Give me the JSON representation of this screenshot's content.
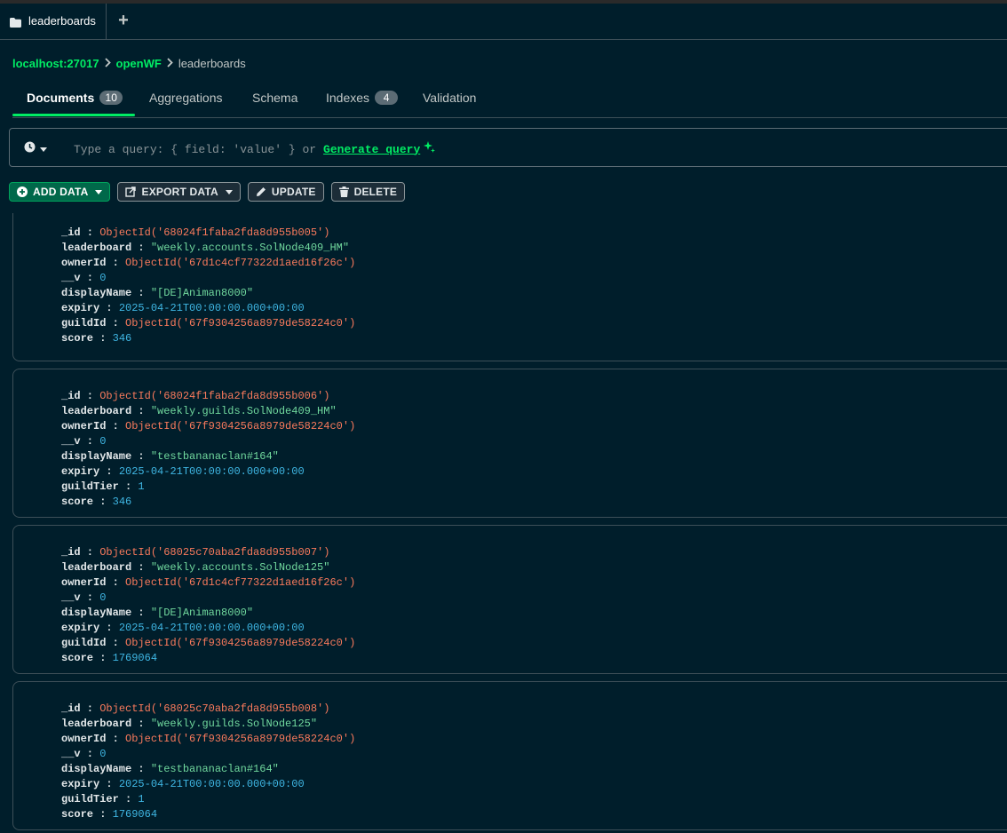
{
  "tab": {
    "label": "leaderboards",
    "new_tab": "+"
  },
  "breadcrumb": {
    "host": "localhost:27017",
    "db": "openWF",
    "collection": "leaderboards"
  },
  "nav": {
    "documents": "Documents",
    "documents_count": "10",
    "aggregations": "Aggregations",
    "schema": "Schema",
    "indexes": "Indexes",
    "indexes_count": "4",
    "validation": "Validation"
  },
  "query": {
    "placeholder": "Type a query: { field: 'value' } or",
    "generate": "Generate query"
  },
  "toolbar": {
    "add": "ADD DATA",
    "export": "EXPORT DATA",
    "update": "UPDATE",
    "delete": "DELETE"
  },
  "documents": [
    {
      "rows": [
        {
          "k": "_id",
          "v": "ObjectId('68024f1faba2fda8d955b005')",
          "t": "oid"
        },
        {
          "k": "leaderboard",
          "v": "\"weekly.accounts.SolNode409_HM\"",
          "t": "str"
        },
        {
          "k": "ownerId",
          "v": "ObjectId('67d1c4cf77322d1aed16f26c')",
          "t": "oid"
        },
        {
          "k": "__v",
          "v": "0",
          "t": "num"
        },
        {
          "k": "displayName",
          "v": "\"[DE]Animan8000\"",
          "t": "str"
        },
        {
          "k": "expiry",
          "v": "2025-04-21T00:00:00.000+00:00",
          "t": "date"
        },
        {
          "k": "guildId",
          "v": "ObjectId('67f9304256a8979de58224c0')",
          "t": "oid"
        },
        {
          "k": "score",
          "v": "346",
          "t": "num"
        }
      ]
    },
    {
      "rows": [
        {
          "k": "_id",
          "v": "ObjectId('68024f1faba2fda8d955b006')",
          "t": "oid"
        },
        {
          "k": "leaderboard",
          "v": "\"weekly.guilds.SolNode409_HM\"",
          "t": "str"
        },
        {
          "k": "ownerId",
          "v": "ObjectId('67f9304256a8979de58224c0')",
          "t": "oid"
        },
        {
          "k": "__v",
          "v": "0",
          "t": "num"
        },
        {
          "k": "displayName",
          "v": "\"testbananaclan#164\"",
          "t": "str"
        },
        {
          "k": "expiry",
          "v": "2025-04-21T00:00:00.000+00:00",
          "t": "date"
        },
        {
          "k": "guildTier",
          "v": "1",
          "t": "num"
        },
        {
          "k": "score",
          "v": "346",
          "t": "num"
        }
      ]
    },
    {
      "rows": [
        {
          "k": "_id",
          "v": "ObjectId('68025c70aba2fda8d955b007')",
          "t": "oid"
        },
        {
          "k": "leaderboard",
          "v": "\"weekly.accounts.SolNode125\"",
          "t": "str"
        },
        {
          "k": "ownerId",
          "v": "ObjectId('67d1c4cf77322d1aed16f26c')",
          "t": "oid"
        },
        {
          "k": "__v",
          "v": "0",
          "t": "num"
        },
        {
          "k": "displayName",
          "v": "\"[DE]Animan8000\"",
          "t": "str"
        },
        {
          "k": "expiry",
          "v": "2025-04-21T00:00:00.000+00:00",
          "t": "date"
        },
        {
          "k": "guildId",
          "v": "ObjectId('67f9304256a8979de58224c0')",
          "t": "oid"
        },
        {
          "k": "score",
          "v": "1769064",
          "t": "num"
        }
      ]
    },
    {
      "rows": [
        {
          "k": "_id",
          "v": "ObjectId('68025c70aba2fda8d955b008')",
          "t": "oid"
        },
        {
          "k": "leaderboard",
          "v": "\"weekly.guilds.SolNode125\"",
          "t": "str"
        },
        {
          "k": "ownerId",
          "v": "ObjectId('67f9304256a8979de58224c0')",
          "t": "oid"
        },
        {
          "k": "__v",
          "v": "0",
          "t": "num"
        },
        {
          "k": "displayName",
          "v": "\"testbananaclan#164\"",
          "t": "str"
        },
        {
          "k": "expiry",
          "v": "2025-04-21T00:00:00.000+00:00",
          "t": "date"
        },
        {
          "k": "guildTier",
          "v": "1",
          "t": "num"
        },
        {
          "k": "score",
          "v": "1769064",
          "t": "num"
        }
      ]
    }
  ]
}
